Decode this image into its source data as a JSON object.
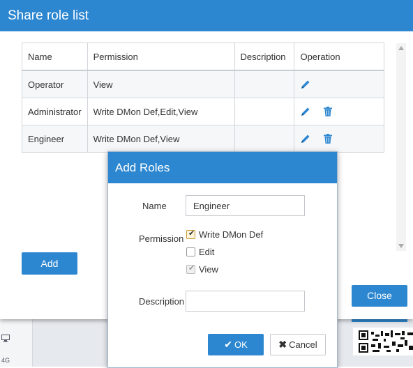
{
  "background": {
    "monitor_icon": "monitor-icon",
    "network_label": "4G"
  },
  "dialog": {
    "title": "Share role list",
    "table": {
      "headers": [
        "Name",
        "Permission",
        "Description",
        "Operation"
      ],
      "rows": [
        {
          "name": "Operator",
          "permission": "View",
          "description": "",
          "edit": true,
          "delete": false
        },
        {
          "name": "Administrator",
          "permission": "Write DMon Def,Edit,View",
          "description": "",
          "edit": true,
          "delete": true
        },
        {
          "name": "Engineer",
          "permission": "Write DMon Def,View",
          "description": "",
          "edit": true,
          "delete": true
        }
      ]
    },
    "add_label": "Add",
    "close_label": "Close"
  },
  "modal": {
    "title": "Add Roles",
    "name_label": "Name",
    "name_value": "Engineer",
    "permission_label": "Permission",
    "permissions": [
      {
        "label": "Write DMon Def",
        "checked": true,
        "disabled": false
      },
      {
        "label": "Edit",
        "checked": false,
        "disabled": false
      },
      {
        "label": "View",
        "checked": true,
        "disabled": true
      }
    ],
    "description_label": "Description",
    "description_value": "",
    "ok_label": "OK",
    "cancel_label": "Cancel"
  },
  "colors": {
    "accent": "#2d87d0",
    "delete_icon": "#2d87d0",
    "edit_icon": "#2d87d0"
  }
}
